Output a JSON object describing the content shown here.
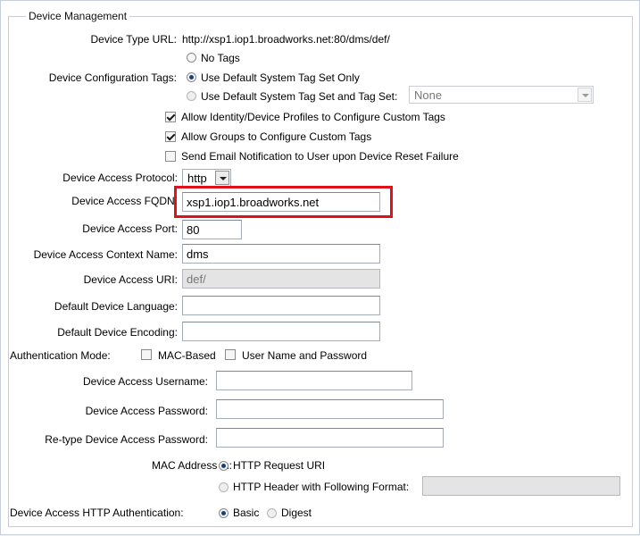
{
  "section": {
    "legend": "Device Management"
  },
  "device_type_url": {
    "label": "Device Type URL:",
    "value": "http://xsp1.iop1.broadworks.net:80/dms/def/"
  },
  "config_tags": {
    "label": "Device Configuration Tags:",
    "options": [
      {
        "label": "No Tags",
        "selected": false
      },
      {
        "label": "Use Default System Tag Set Only",
        "selected": true
      },
      {
        "label": "Use Default System Tag Set and Tag Set:",
        "selected": false
      }
    ],
    "tag_set_value": "None"
  },
  "checkboxes": [
    {
      "label": "Allow Identity/Device Profiles to Configure Custom Tags",
      "checked": true
    },
    {
      "label": "Allow Groups to Configure Custom Tags",
      "checked": true
    },
    {
      "label": "Send Email Notification to User upon Device Reset Failure",
      "checked": false
    }
  ],
  "access_protocol": {
    "label": "Device Access Protocol:",
    "value": "http"
  },
  "access_fqdn": {
    "label": "Device Access FQDN:",
    "value": "xsp1.iop1.broadworks.net"
  },
  "access_port": {
    "label": "Device Access Port:",
    "value": "80"
  },
  "context_name": {
    "label": "Device Access Context Name:",
    "value": "dms"
  },
  "access_uri": {
    "label": "Device Access URI:",
    "value": "def/"
  },
  "device_language": {
    "label": "Default Device Language:",
    "value": ""
  },
  "device_encoding": {
    "label": "Default Device Encoding:",
    "value": ""
  },
  "auth_mode": {
    "label": "Authentication Mode:",
    "mac_label": "MAC-Based",
    "mac_checked": false,
    "user_label": "User Name and Password",
    "user_checked": false
  },
  "username": {
    "label": "Device Access Username:",
    "value": ""
  },
  "password": {
    "label": "Device Access Password:",
    "value": ""
  },
  "retype_password": {
    "label": "Re-type Device Access Password:",
    "value": ""
  },
  "mac_address_in": {
    "label": "MAC Address In:",
    "options": [
      {
        "label": "HTTP Request URI",
        "selected": true
      },
      {
        "label": "HTTP Header with Following Format:",
        "selected": false
      }
    ],
    "format_value": ""
  },
  "http_auth": {
    "label": "Device Access HTTP Authentication:",
    "options": [
      {
        "label": "Basic",
        "selected": true
      },
      {
        "label": "Digest",
        "selected": false
      }
    ]
  },
  "colors": {
    "highlight": "#e0111b",
    "radio_dot": "#1c3f73",
    "border": "#c9cdd3"
  }
}
